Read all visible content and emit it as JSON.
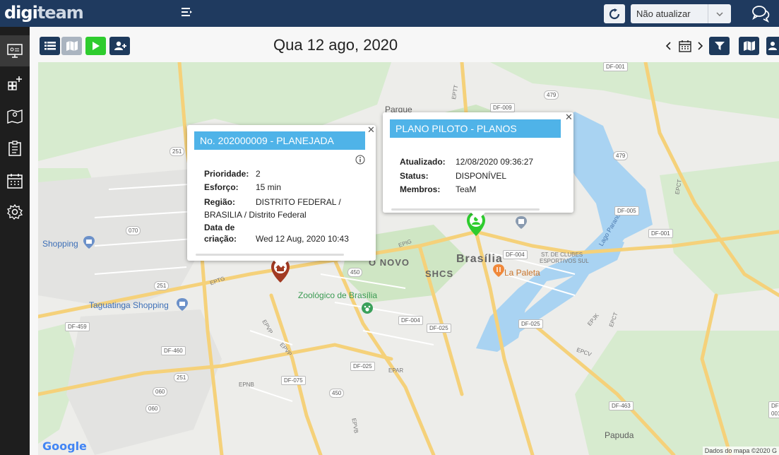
{
  "header": {
    "logo_part1": "digi",
    "logo_part2": "team",
    "refresh_select_value": "Não atualizar"
  },
  "toolbar": {
    "date_title": "Qua 12 ago, 2020"
  },
  "map": {
    "labels": {
      "parque": "Parque",
      "novo": "O NOVO",
      "brasilia": "Brasília",
      "shopping": "Shopping",
      "taguatinga_shopping": "Taguatinga Shopping",
      "shcs": "SHCS",
      "la_paleta": "La Paleta",
      "zoo": "Zoológico de Brasília",
      "st_clubes": "ST. DE CLUBES",
      "esportivos_sul": "ESPORTIVOS SUL",
      "lago_paranoa": "Lago Paranoá",
      "papuda": "Papuda",
      "eptg": "EPTG",
      "epig": "EPIG",
      "epvp": "EPVP",
      "epvp2": "EPVP",
      "epnb": "EPNB",
      "epvb": "EPVB",
      "epdb": "EPAR",
      "epjk": "EPJK",
      "epct1": "EPCT",
      "epct2": "EPCT",
      "epcv": "EPCV",
      "eptt": "EPTT"
    },
    "shields": {
      "df001_top": "DF-001",
      "df009": "DF-009",
      "r479a": "479",
      "r479b": "479",
      "r251a": "251",
      "r251b": "251",
      "r251c": "251",
      "r070": "070",
      "df005": "DF-005",
      "df001_right": "DF-001",
      "df004a": "DF-004",
      "df004b": "DF-004",
      "df025a": "DF-025",
      "df025b": "DF-025",
      "df025c": "DF-025",
      "r450a": "450",
      "r450b": "450",
      "df459": "DF-459",
      "df460": "DF-460",
      "df075": "DF-075",
      "r060": "060",
      "r060b": "060",
      "df463": "DF-463",
      "df001_br": "DF-001"
    },
    "google_logo": "Google",
    "attribution": "Dados do mapa ©2020 G"
  },
  "popup_order": {
    "title": "No. 202000009 - PLANEJADA",
    "rows": [
      {
        "key": "Prioridade:",
        "value": "2"
      },
      {
        "key": "Esforço:",
        "value": "15 min"
      },
      {
        "key": "Região:",
        "value": "DISTRITO FEDERAL /"
      },
      {
        "key": "",
        "value": "BRASILIA / Distrito Federal"
      },
      {
        "key": "Data de",
        "value": ""
      },
      {
        "key": "criação:",
        "value": "Wed 12 Aug, 2020 10:43"
      }
    ]
  },
  "popup_team": {
    "title": "PLANO PILOTO - PLANOS",
    "rows": [
      {
        "key": "Atualizado:",
        "value": "12/08/2020 09:36:27"
      },
      {
        "key": "Status:",
        "value": "DISPONÍVEL"
      },
      {
        "key": "Membros:",
        "value": "TeaM"
      }
    ]
  },
  "colors": {
    "header_bg": "#1f3a5f",
    "popup_header": "#4fb3e8",
    "order_pin": "#a23a22",
    "team_pin": "#2ecc2e"
  }
}
